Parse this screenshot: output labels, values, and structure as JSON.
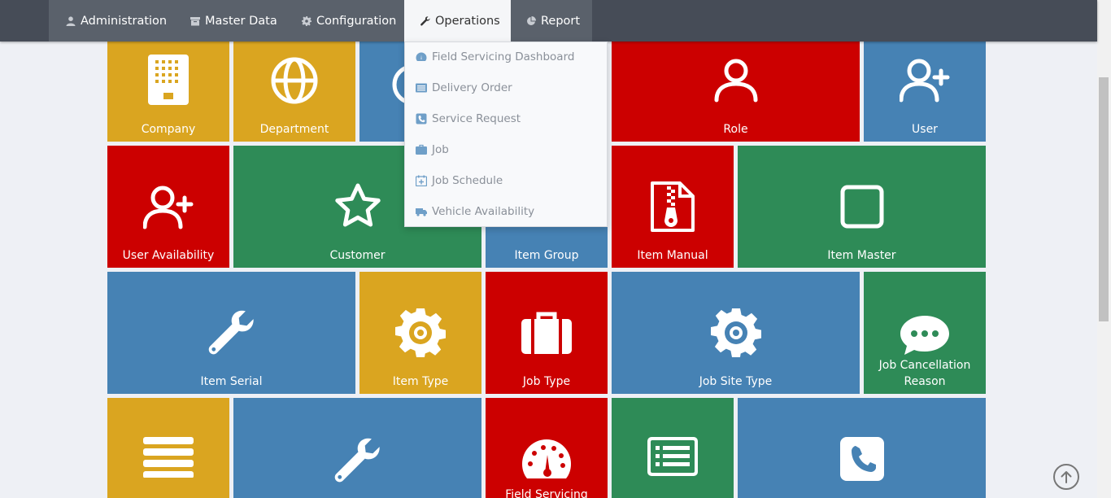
{
  "nav": {
    "items": [
      {
        "label": "Administration",
        "icon": "user-icon"
      },
      {
        "label": "Master Data",
        "icon": "archive-icon"
      },
      {
        "label": "Configuration",
        "icon": "gear-icon"
      },
      {
        "label": "Operations",
        "icon": "wrench-icon",
        "active": true
      },
      {
        "label": "Report",
        "icon": "pie-chart-icon"
      }
    ]
  },
  "operations_menu": {
    "items": [
      {
        "label": "Field Servicing Dashboard",
        "icon": "dashboard-icon"
      },
      {
        "label": "Delivery Order",
        "icon": "list-icon"
      },
      {
        "label": "Service Request",
        "icon": "phone-icon"
      },
      {
        "label": "Job",
        "icon": "briefcase-icon"
      },
      {
        "label": "Job Schedule",
        "icon": "calendar-plus-icon"
      },
      {
        "label": "Vehicle Availability",
        "icon": "truck-icon"
      }
    ]
  },
  "tiles": {
    "company": "Company",
    "department": "Department",
    "role": "Role",
    "user": "User",
    "user_availability": "User Availability",
    "customer": "Customer",
    "item_group": "Item Group",
    "item_manual": "Item Manual",
    "item_master": "Item Master",
    "item_serial": "Item Serial",
    "item_type": "Item Type",
    "job_type": "Job Type",
    "job_site_type": "Job Site Type",
    "job_cancellation_reason": "Job Cancellation Reason",
    "field_servicing": "Field Servicing"
  },
  "colors": {
    "yellow": "#daa520",
    "blue": "#4682b4",
    "red": "#cc0000",
    "green": "#2e8b57",
    "topbar": "#464c57"
  }
}
